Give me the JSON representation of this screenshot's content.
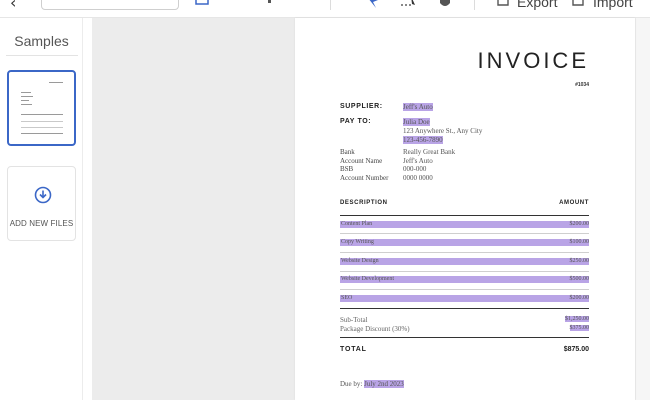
{
  "toolbar": {
    "export_label": "Export",
    "import_label": "Import",
    "icons": [
      "back-arrow-icon",
      "text-box-icon",
      "link-icon",
      "pin-icon",
      "select-icon",
      "hand-icon",
      "export-icon",
      "import-icon"
    ]
  },
  "sidebar": {
    "title": "Samples",
    "add_files_label": "ADD NEW FILES"
  },
  "invoice": {
    "title": "INVOICE",
    "number": "#1034",
    "supplier_label": "SUPPLIER:",
    "supplier_value": "Jeff's Auto",
    "payto_label": "PAY TO:",
    "payto_lines": [
      "Julia Doe",
      "123 Anywhere St., Any City",
      "123-456-7890"
    ],
    "bank_rows": [
      {
        "label": "Bank",
        "value": "Really Great Bank"
      },
      {
        "label": "Account Name",
        "value": "Jeff's Auto"
      },
      {
        "label": "BSB",
        "value": "000-000"
      },
      {
        "label": "Account Number",
        "value": "0000 0000"
      }
    ],
    "col_description": "DESCRIPTION",
    "col_amount": "AMOUNT",
    "items": [
      {
        "description": "Content Plan",
        "amount": "$200.00"
      },
      {
        "description": "Copy Writing",
        "amount": "$100.00"
      },
      {
        "description": "Website Design",
        "amount": "$250.00"
      },
      {
        "description": "Website Development",
        "amount": "$500.00"
      },
      {
        "description": "SEO",
        "amount": "$200.00"
      }
    ],
    "subtotal_label": "Sub-Total",
    "subtotal_value": "$1,250.00",
    "discount_label": "Package Discount (30%)",
    "discount_value": "$375.00",
    "total_label": "TOTAL",
    "total_value": "$875.00",
    "due_prefix": "Due by:",
    "due_date": "July 2nd 2023"
  },
  "colors": {
    "highlight": "#b9a4e6",
    "accent": "#3b67c7",
    "canvas": "#ececec"
  }
}
